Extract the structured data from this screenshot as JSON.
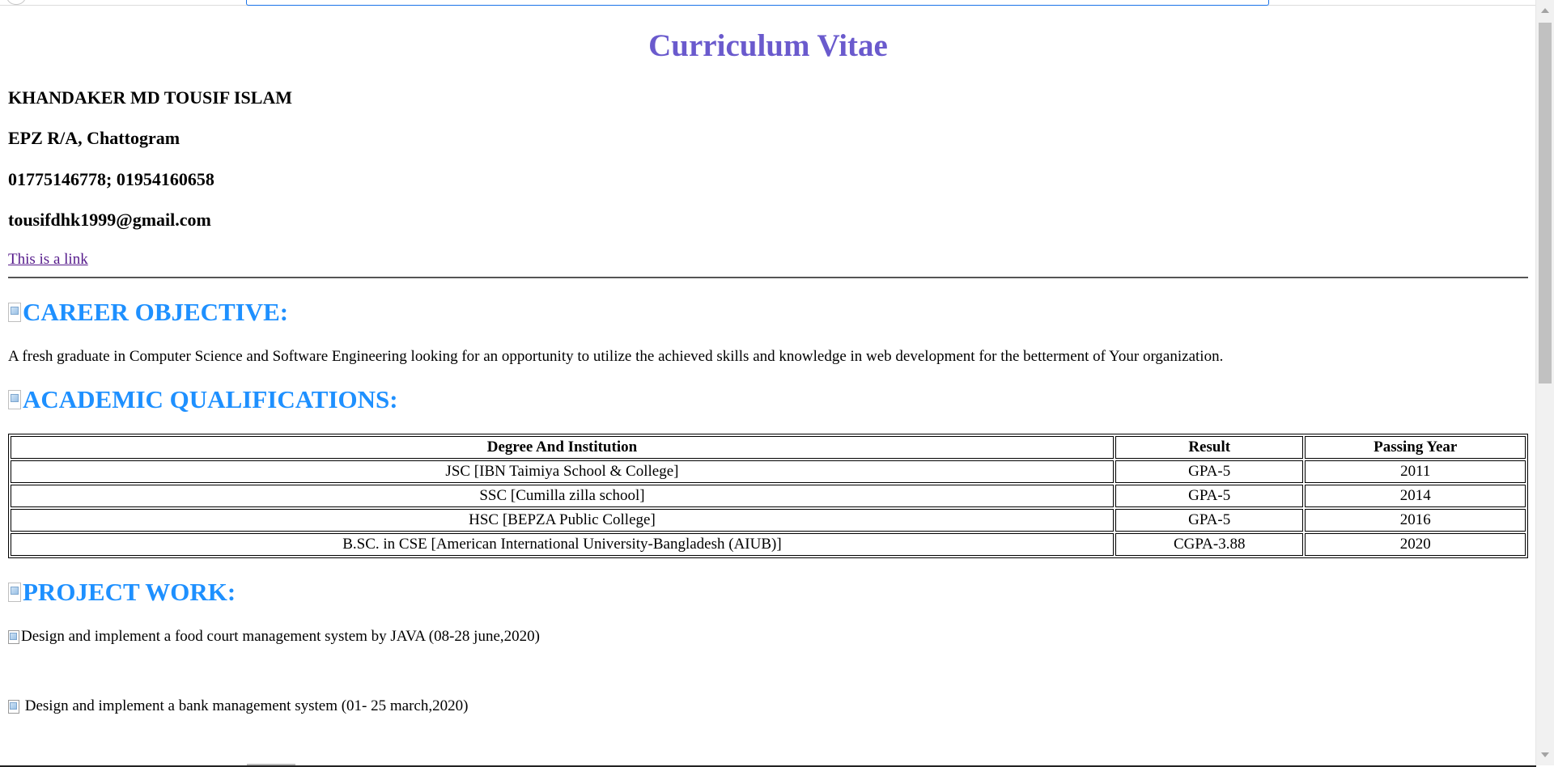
{
  "header": {
    "title": "Curriculum Vitae",
    "name": "KHANDAKER MD TOUSIF ISLAM",
    "address": "EPZ R/A, Chattogram",
    "phone": "01775146778; 01954160658",
    "email": "tousifdhk1999@gmail.com",
    "link_text": "This is a link"
  },
  "career": {
    "heading": "CAREER OBJECTIVE:",
    "text": "A fresh graduate in Computer Science and Software Engineering looking for an opportunity to utilize the achieved skills and knowledge in web development for the betterment of Your organization."
  },
  "academic": {
    "heading": "ACADEMIC QUALIFICATIONS:",
    "columns": [
      "Degree And Institution",
      "Result",
      "Passing Year"
    ],
    "rows": [
      [
        "JSC [IBN Taimiya School & College]",
        "GPA-5",
        "2011"
      ],
      [
        "SSC [Cumilla zilla school]",
        "GPA-5",
        "2014"
      ],
      [
        "HSC [BEPZA Public College]",
        "GPA-5",
        "2016"
      ],
      [
        "B.SC. in CSE [American International University-Bangladesh (AIUB)]",
        "CGPA-3.88",
        "2020"
      ]
    ]
  },
  "projects": {
    "heading": "PROJECT WORK:",
    "items": [
      "Design and implement a food court management system by JAVA (08-28 june,2020)",
      " Design and implement a bank management system (01- 25 march,2020)"
    ]
  },
  "icons": {
    "broken_image": "broken-image-icon"
  },
  "colors": {
    "title": "#6a5acd",
    "section_heading": "#1e90ff",
    "link": "#551a8b"
  }
}
